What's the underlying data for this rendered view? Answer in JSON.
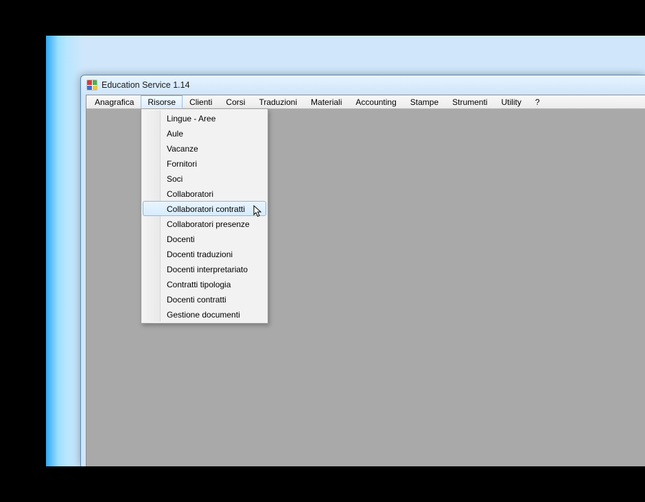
{
  "window": {
    "title": "Education Service 1.14"
  },
  "menubar": {
    "items": [
      "Anagrafica",
      "Risorse",
      "Clienti",
      "Corsi",
      "Traduzioni",
      "Materiali",
      "Accounting",
      "Stampe",
      "Strumenti",
      "Utility",
      "?"
    ],
    "open_index": 1
  },
  "dropdown": {
    "items": [
      "Lingue - Aree",
      "Aule",
      "Vacanze",
      "Fornitori",
      "Soci",
      "Collaboratori",
      "Collaboratori contratti",
      "Collaboratori presenze",
      "Docenti",
      "Docenti traduzioni",
      "Docenti interpretariato",
      "Contratti tipologia",
      "Docenti contratti",
      "Gestione documenti"
    ],
    "hover_index": 6
  }
}
